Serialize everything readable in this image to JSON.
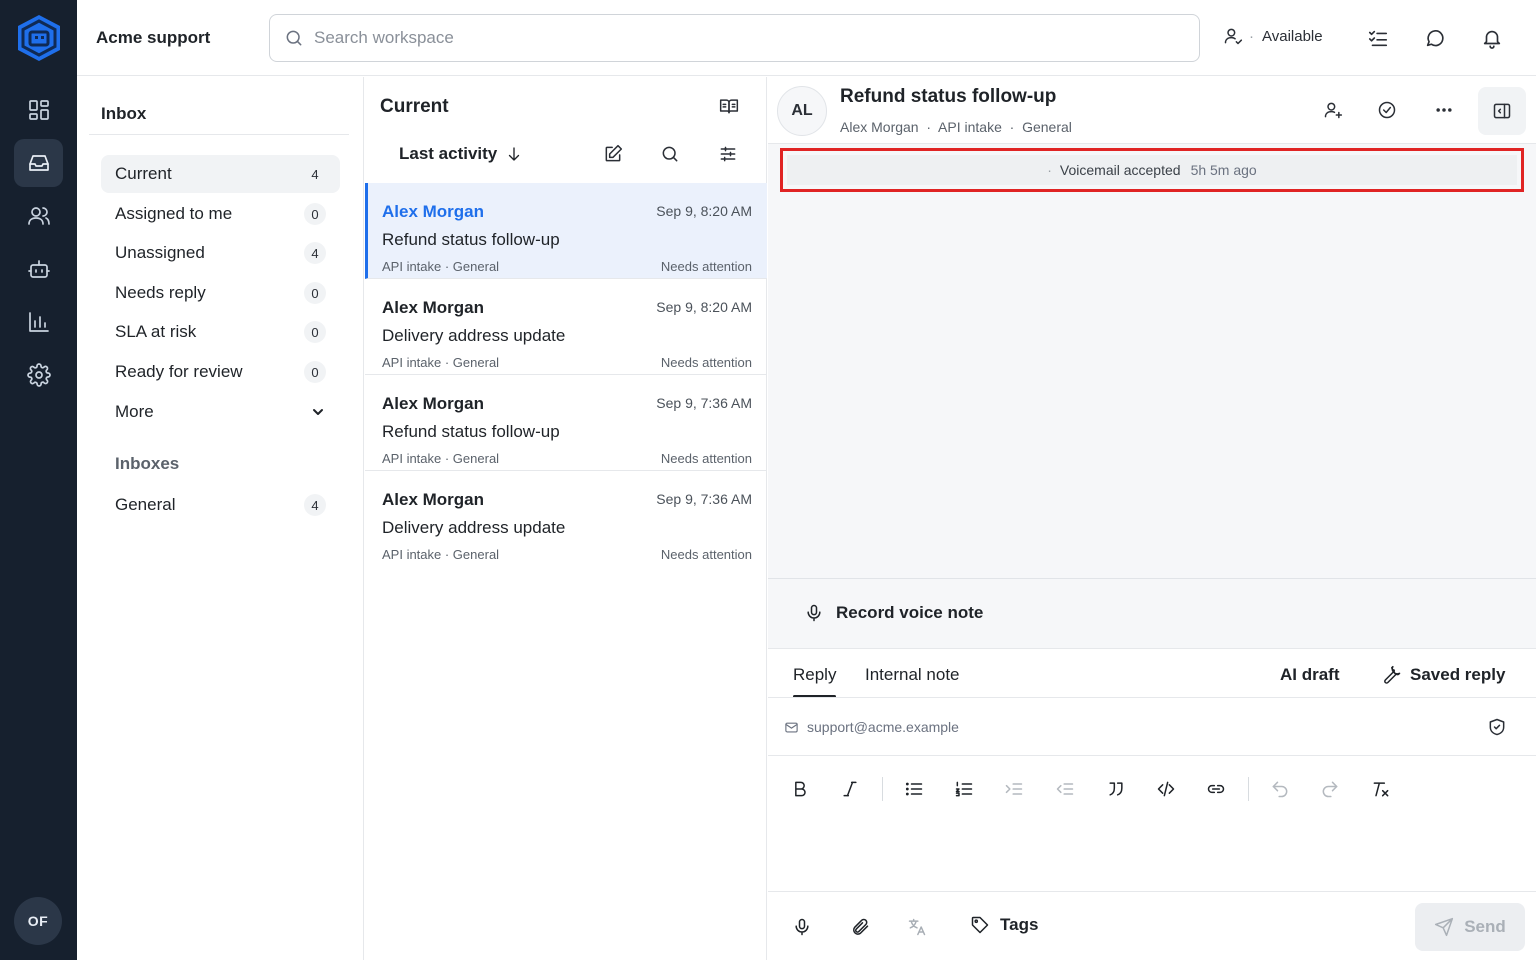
{
  "app": {
    "org_name": "Acme support",
    "user_initials": "OF"
  },
  "search": {
    "placeholder": "Search workspace"
  },
  "presence": {
    "label": "Available"
  },
  "rail": {
    "items": [
      "dashboard-icon",
      "inbox-icon",
      "contacts-icon",
      "bot-icon",
      "reports-icon",
      "settings-icon"
    ],
    "active": "inbox-icon"
  },
  "inbox": {
    "title": "Inbox",
    "items": [
      {
        "label": "Current",
        "count": "4"
      },
      {
        "label": "Assigned to me",
        "count": "0"
      },
      {
        "label": "Unassigned",
        "count": "4"
      },
      {
        "label": "Needs reply",
        "count": "0"
      },
      {
        "label": "SLA at risk",
        "count": "0"
      },
      {
        "label": "Ready for review",
        "count": "0"
      }
    ],
    "more_label": "More",
    "inboxes_heading": "Inboxes",
    "inboxes": [
      {
        "label": "General",
        "count": "4"
      }
    ]
  },
  "list": {
    "title": "Current",
    "sort_label": "Last activity",
    "conversations": [
      {
        "name": "Alex Morgan",
        "time": "Sep 9, 8:20 AM",
        "subject": "Refund status follow-up",
        "meta": "API intake · General",
        "status": "Needs attention"
      },
      {
        "name": "Alex Morgan",
        "time": "Sep 9, 8:20 AM",
        "subject": "Delivery address update",
        "meta": "API intake · General",
        "status": "Needs attention"
      },
      {
        "name": "Alex Morgan",
        "time": "Sep 9, 7:36 AM",
        "subject": "Refund status follow-up",
        "meta": "API intake · General",
        "status": "Needs attention"
      },
      {
        "name": "Alex Morgan",
        "time": "Sep 9, 7:36 AM",
        "subject": "Delivery address update",
        "meta": "API intake · General",
        "status": "Needs attention"
      }
    ]
  },
  "conversation": {
    "avatar": "AL",
    "title": "Refund status follow-up",
    "meta": "Alex Morgan  ·  API intake  ·  General",
    "event": {
      "bullet": "·",
      "text": "Voicemail accepted",
      "ago": "5h 5m ago"
    }
  },
  "composer": {
    "voice_label": "Record voice note",
    "tabs": [
      "Reply",
      "Internal note"
    ],
    "ai_draft": "AI draft",
    "saved_reply": "Saved reply",
    "from": "support@acme.example",
    "tags_label": "Tags",
    "send_label": "Send"
  },
  "colors": {
    "rail_bg": "#16202e",
    "accent": "#1f6feb",
    "highlight_border": "#e02424"
  }
}
